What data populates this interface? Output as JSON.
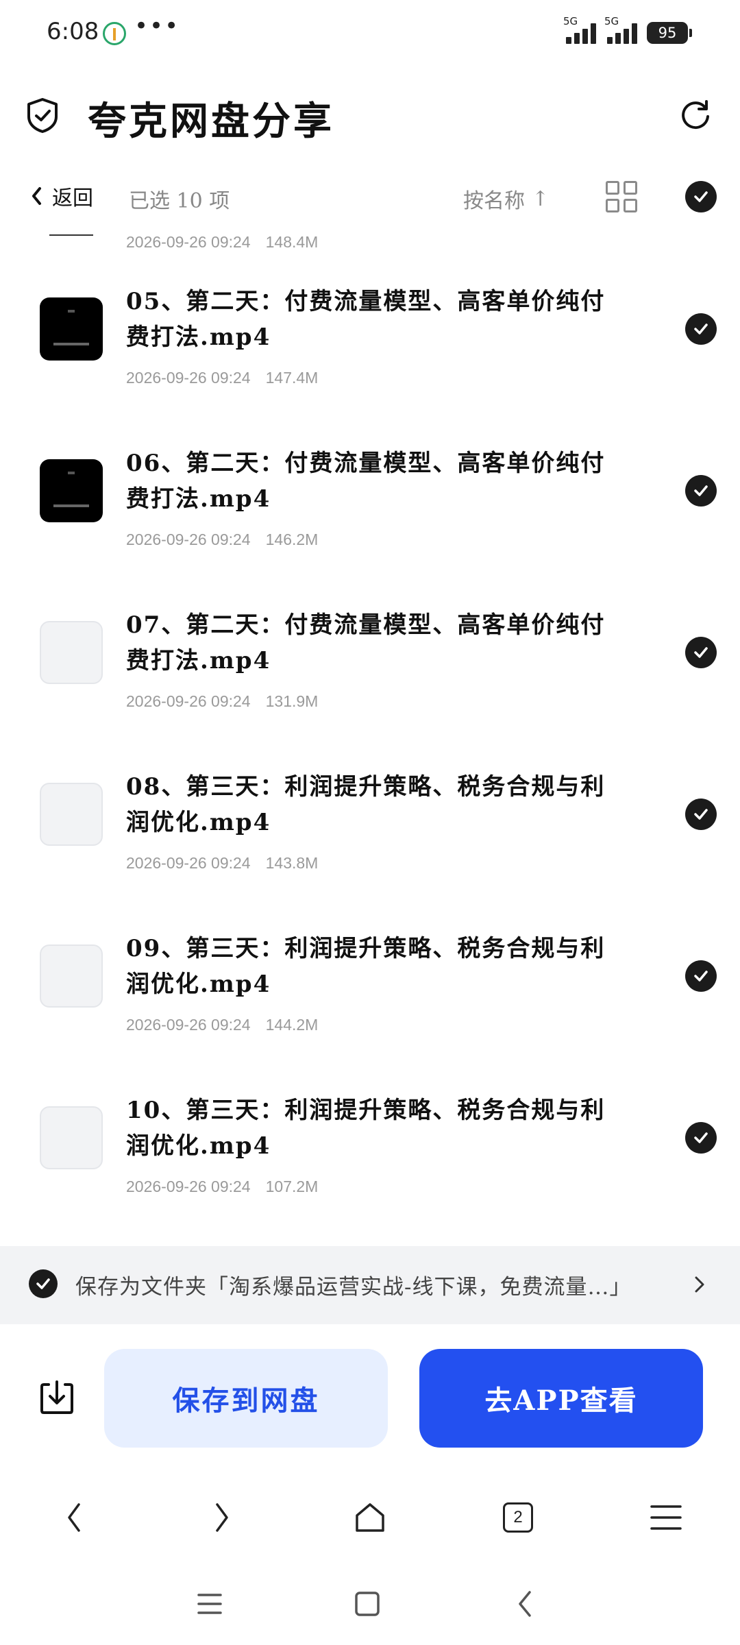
{
  "status_bar": {
    "time": "6:08",
    "dots": "•••",
    "signal1_label": "5G",
    "signal2_label": "5G",
    "battery": "95"
  },
  "header": {
    "title": "夸克网盘分享",
    "refresh_icon": "refresh-icon",
    "shield_icon": "shield-check-icon"
  },
  "toolbar": {
    "back_label": "返回",
    "selected_label": "已选 10 项",
    "sort_label": "按名称",
    "sort_arrow": "↑"
  },
  "partial_item": {
    "date": "2026-09-26 09:24",
    "size": "148.4M"
  },
  "files": [
    {
      "name": "05、第二天：付费流量模型、高客单价纯付费打法.mp4",
      "date": "2026-09-26 09:24",
      "size": "147.4M",
      "thumb": "dark",
      "checked": true
    },
    {
      "name": "06、第二天：付费流量模型、高客单价纯付费打法.mp4",
      "date": "2026-09-26 09:24",
      "size": "146.2M",
      "thumb": "dark",
      "checked": true
    },
    {
      "name": "07、第二天：付费流量模型、高客单价纯付费打法.mp4",
      "date": "2026-09-26 09:24",
      "size": "131.9M",
      "thumb": "blank",
      "checked": true
    },
    {
      "name": "08、第三天：利润提升策略、税务合规与利润优化.mp4",
      "date": "2026-09-26 09:24",
      "size": "143.8M",
      "thumb": "blank",
      "checked": true
    },
    {
      "name": "09、第三天：利润提升策略、税务合规与利润优化.mp4",
      "date": "2026-09-26 09:24",
      "size": "144.2M",
      "thumb": "blank",
      "checked": true
    },
    {
      "name": "10、第三天：利润提升策略、税务合规与利润优化.mp4",
      "date": "2026-09-26 09:24",
      "size": "107.2M",
      "thumb": "blank",
      "checked": true
    }
  ],
  "save_folder": {
    "text": "保存为文件夹「淘系爆品运营实战-线下课，免费流量…」"
  },
  "actions": {
    "save_label": "保存到网盘",
    "app_label": "去APP查看"
  },
  "browser_nav": {
    "tab_count": "2"
  },
  "colors": {
    "accent": "#2350f0",
    "accent_light": "#e7efff",
    "check": "#1b1b1b"
  }
}
